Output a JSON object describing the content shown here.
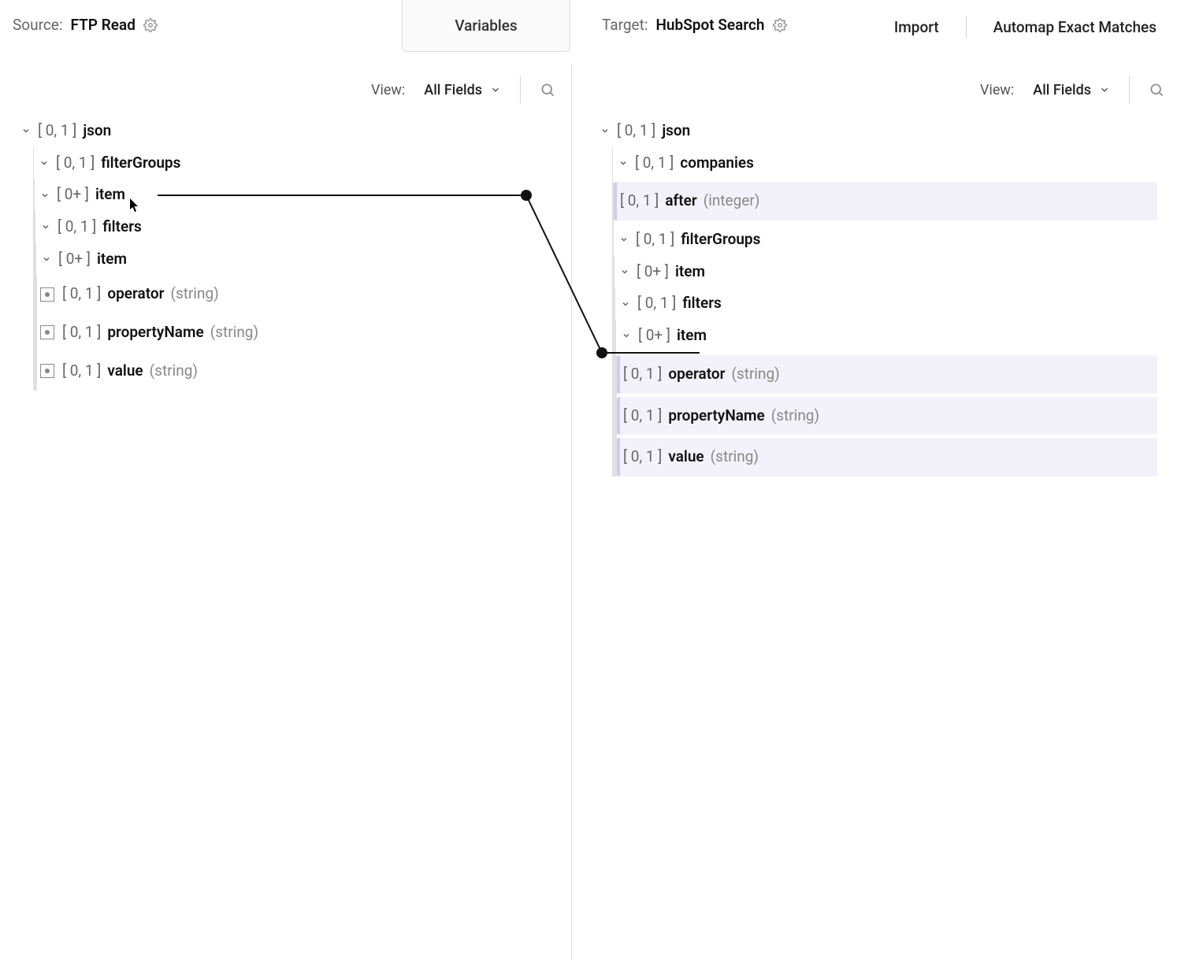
{
  "header": {
    "source_label": "Source:",
    "source_value": "FTP Read",
    "target_label": "Target:",
    "target_value": "HubSpot Search",
    "variables_tab": "Variables",
    "import_action": "Import",
    "automap_action": "Automap Exact Matches"
  },
  "controls": {
    "view_label": "View:",
    "view_value": "All Fields"
  },
  "card": {
    "zero_one": "[ 0, 1 ]",
    "zero_plus": "[ 0+ ]"
  },
  "types": {
    "string": "(string)",
    "integer": "(integer)"
  },
  "source_tree": {
    "json": "json",
    "filterGroups": "filterGroups",
    "item1": "item",
    "filters": "filters",
    "item2": "item",
    "operator": "operator",
    "propertyName": "propertyName",
    "value": "value"
  },
  "target_tree": {
    "json": "json",
    "companies": "companies",
    "after": "after",
    "filterGroups": "filterGroups",
    "item1": "item",
    "filters": "filters",
    "item2": "item",
    "operator": "operator",
    "propertyName": "propertyName",
    "value": "value"
  }
}
